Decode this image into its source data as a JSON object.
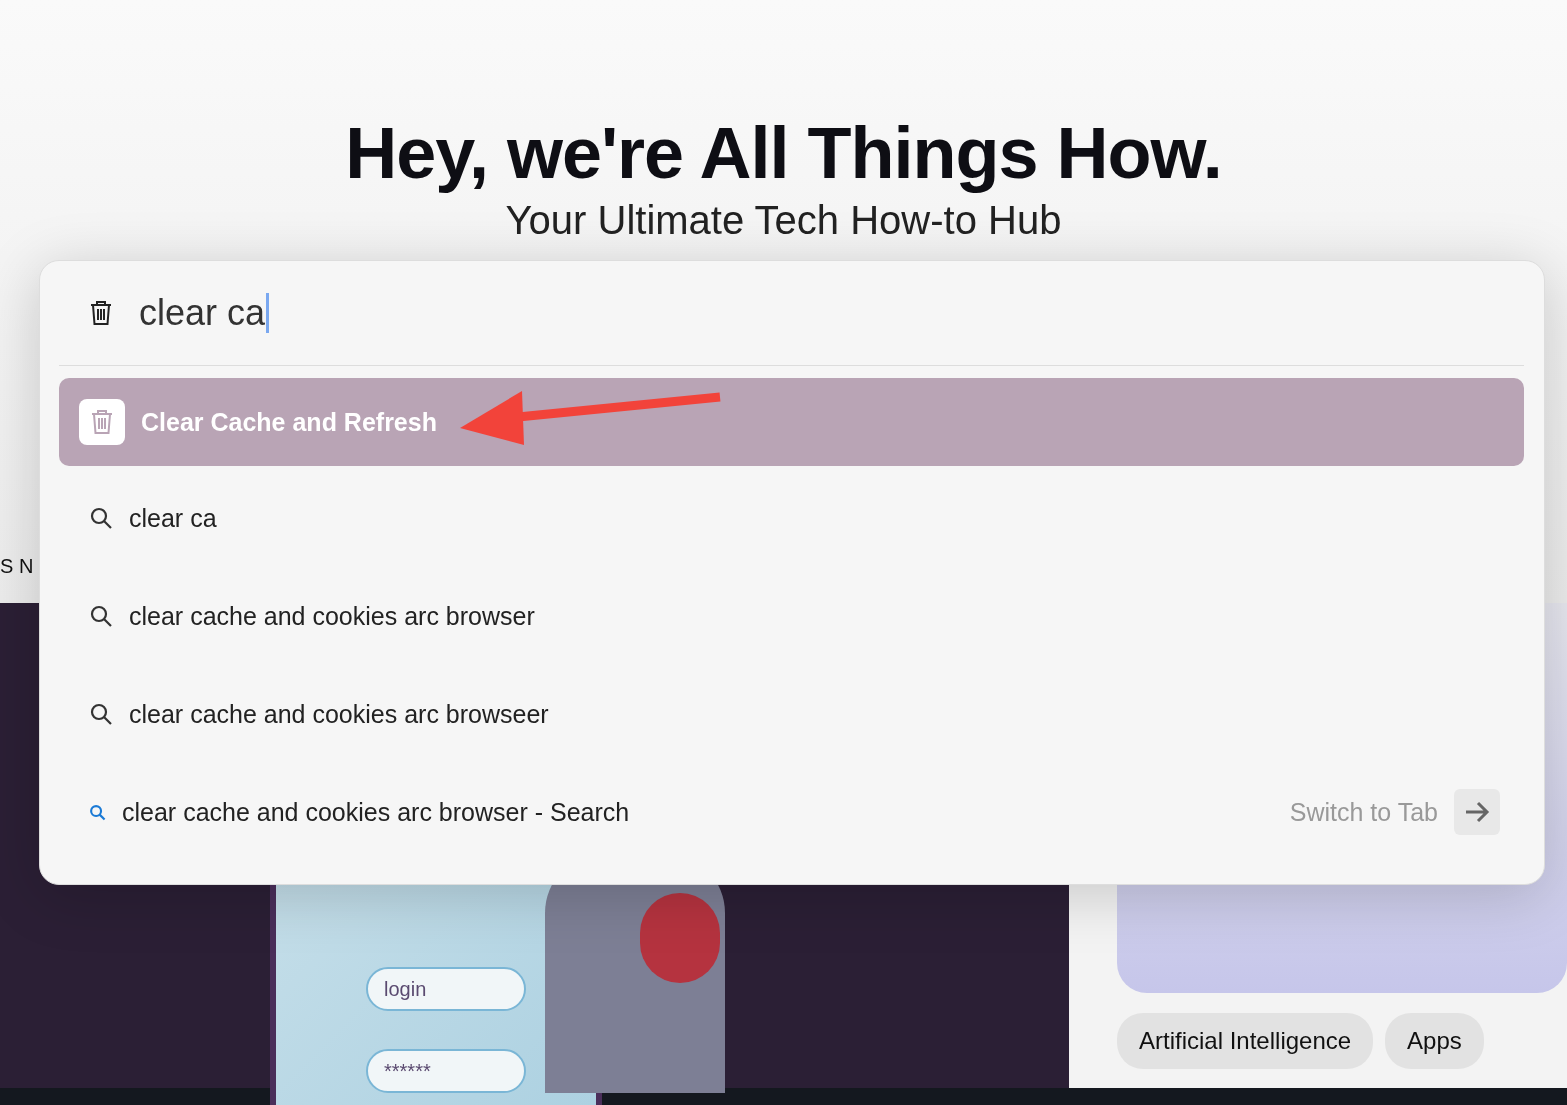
{
  "page": {
    "heading": "Hey, we're All Things How.",
    "subtitle": "Your Ultimate Tech How-to Hub",
    "edge_text": "S N",
    "illustration": {
      "fields": [
        "login",
        "******"
      ]
    },
    "tags": [
      "Artificial Intelligence",
      "Apps"
    ]
  },
  "command_bar": {
    "query": "clear ca",
    "results": [
      {
        "kind": "command",
        "label": "Clear Cache and Refresh",
        "selected": true
      },
      {
        "kind": "search",
        "label": "clear ca",
        "selected": false
      },
      {
        "kind": "search",
        "label": "clear cache and cookies arc browser",
        "selected": false
      },
      {
        "kind": "search",
        "label": "clear cache and cookies arc browseer",
        "selected": false
      },
      {
        "kind": "tab",
        "label": "clear cache and cookies arc browser - Search",
        "selected": false,
        "action": "Switch to Tab"
      }
    ]
  }
}
